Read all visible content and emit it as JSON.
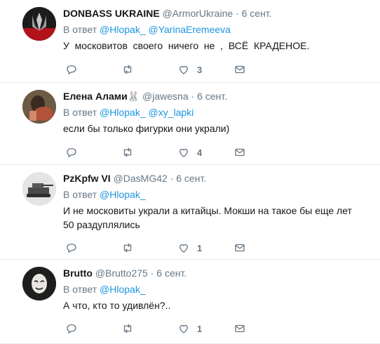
{
  "tweets": [
    {
      "name": "DONBASS UKRAINE",
      "handle": "@ArmorUkraine",
      "dot": "·",
      "time": "6 сент.",
      "reply_prefix": "В ответ",
      "mentions": [
        "@Hlopak_",
        "@YarinaEremeeva"
      ],
      "text": "У  московитов  своего  ничего  не  ,  ВСЁ  КРАДЕНОЕ.",
      "likes": "3"
    },
    {
      "name": "Елена Алами",
      "name_emoji": "🐰",
      "handle": "@jawesna",
      "dot": "·",
      "time": "6 сент.",
      "reply_prefix": "В ответ",
      "mentions": [
        "@Hlopak_",
        "@xy_lapki"
      ],
      "text": "если бы только фигурки они украли)",
      "likes": "4"
    },
    {
      "name": "PzKpfw VI",
      "handle": "@DasMG42",
      "dot": "·",
      "time": "6 сент.",
      "reply_prefix": "В ответ",
      "mentions": [
        "@Hlopak_"
      ],
      "text": "И не московиты украли а китайцы. Мокши на такое бы еще лет 50 раздуплялись",
      "likes": "1"
    },
    {
      "name": "Brutto",
      "handle": "@Brutto275",
      "dot": "·",
      "time": "6 сент.",
      "reply_prefix": "В ответ",
      "mentions": [
        "@Hlopak_"
      ],
      "text": "А что, кто то удивлён?..",
      "likes": "1"
    }
  ],
  "colors": {
    "accent": "#1b95e0",
    "muted": "#657786",
    "divider": "#e6ecf0"
  },
  "icons": [
    "reply-icon",
    "retweet-icon",
    "like-icon",
    "message-icon"
  ]
}
